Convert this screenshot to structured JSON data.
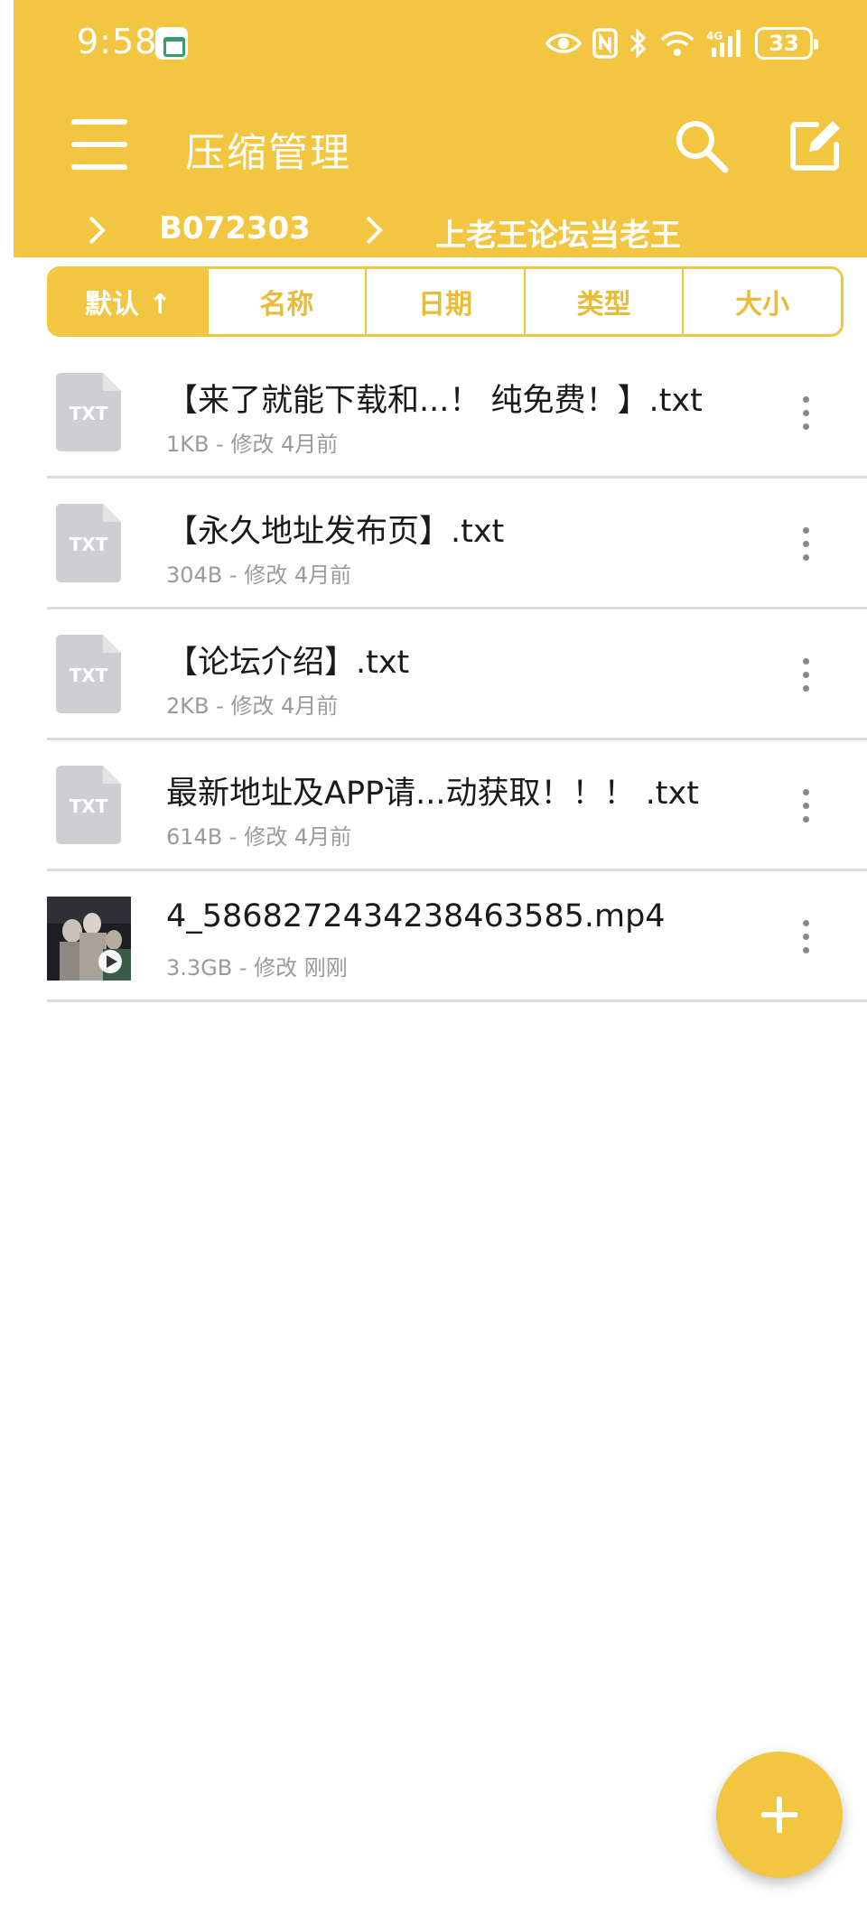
{
  "status_bar": {
    "time": "9:58",
    "battery": "33",
    "icons": [
      "app-notification-icon",
      "eye-icon",
      "nfc-icon",
      "bluetooth-icon",
      "wifi-icon",
      "signal-icon",
      "battery-icon"
    ]
  },
  "header": {
    "title": "压缩管理",
    "menu_icon": "hamburger-menu-icon",
    "search_icon": "search-icon",
    "edit_icon": "edit-icon",
    "accent_color": "#F2C641"
  },
  "breadcrumb": {
    "items": [
      "B072303",
      "上老王论坛当老王"
    ]
  },
  "sort_tabs": {
    "active_index": 0,
    "items": [
      "默认 ↑",
      "名称",
      "日期",
      "类型",
      "大小"
    ]
  },
  "files": [
    {
      "name": "【来了就能下载和...！ 纯免费！】.txt",
      "meta": "1KB - 修改 4月前",
      "type_label": "TXT"
    },
    {
      "name": "【永久地址发布页】.txt",
      "meta": "304B - 修改 4月前",
      "type_label": "TXT"
    },
    {
      "name": "【论坛介绍】.txt",
      "meta": "2KB - 修改 4月前",
      "type_label": "TXT"
    },
    {
      "name": "最新地址及APP请...动获取！！！ .txt",
      "meta": "614B - 修改 4月前",
      "type_label": "TXT"
    },
    {
      "name": "4_5868272434238463585.mp4",
      "meta": "3.3GB - 修改 刚刚",
      "type_label": "video-thumbnail"
    }
  ],
  "fab": {
    "icon": "plus-icon"
  }
}
